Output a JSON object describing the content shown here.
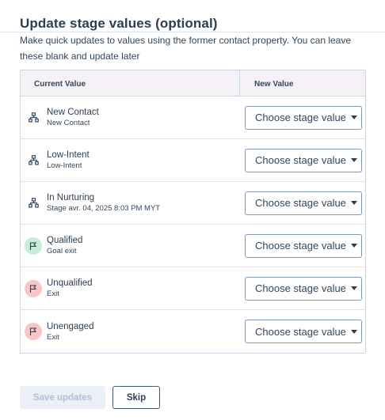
{
  "header": {
    "title": "Update stage values (optional)",
    "subtitle": "Make quick updates to values using the former contact property. You can leave these blank and update later"
  },
  "table": {
    "col_current": "Current Value",
    "col_new": "New Value",
    "select_placeholder": "Choose stage value",
    "rows": [
      {
        "label": "New Contact",
        "sub": "New Contact",
        "icon": "stage-tree-icon"
      },
      {
        "label": "Low-Intent",
        "sub": "Low-Intent",
        "icon": "stage-tree-icon"
      },
      {
        "label": "In Nurturing",
        "sub": "Stage avr. 04, 2025 8:03 PM MYT",
        "icon": "stage-tree-icon"
      },
      {
        "label": "Qualified",
        "sub": "Goal exit",
        "icon": "flag-icon",
        "icon_bg": "#c9ecd6"
      },
      {
        "label": "Unqualified",
        "sub": "Exit",
        "icon": "flag-icon",
        "icon_bg": "#f9c6c6"
      },
      {
        "label": "Unengaged",
        "sub": "Exit",
        "icon": "flag-icon",
        "icon_bg": "#f9c6c6"
      }
    ]
  },
  "footer": {
    "save_label": "Save updates",
    "skip_label": "Skip"
  },
  "colors": {
    "header_bg": "#f5f1f6",
    "goal_exit": "#c9ecd6",
    "exit": "#f9c6c6",
    "disabled_button": "#eaf0f6"
  }
}
